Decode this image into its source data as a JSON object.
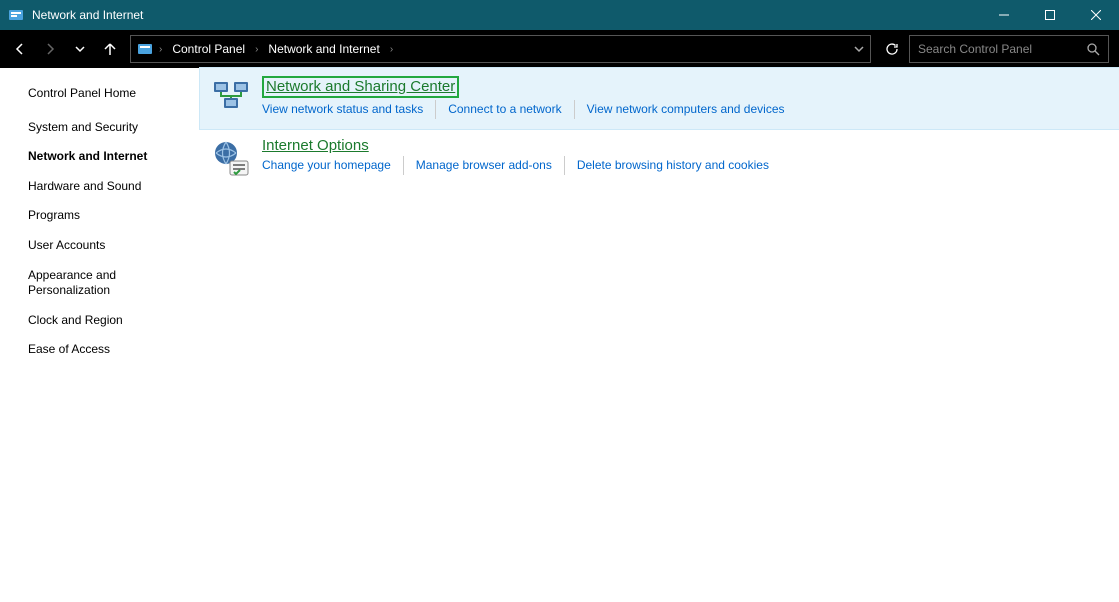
{
  "window": {
    "title": "Network and Internet"
  },
  "breadcrumb": {
    "items": [
      "Control Panel",
      "Network and Internet"
    ]
  },
  "search": {
    "placeholder": "Search Control Panel"
  },
  "sidebar": {
    "home": "Control Panel Home",
    "items": [
      {
        "label": "System and Security",
        "active": false
      },
      {
        "label": "Network and Internet",
        "active": true
      },
      {
        "label": "Hardware and Sound",
        "active": false
      },
      {
        "label": "Programs",
        "active": false
      },
      {
        "label": "User Accounts",
        "active": false
      },
      {
        "label": "Appearance and Personalization",
        "active": false
      },
      {
        "label": "Clock and Region",
        "active": false
      },
      {
        "label": "Ease of Access",
        "active": false
      }
    ]
  },
  "categories": [
    {
      "title": "Network and Sharing Center",
      "highlighted": true,
      "tasks": [
        "View network status and tasks",
        "Connect to a network",
        "View network computers and devices"
      ]
    },
    {
      "title": "Internet Options",
      "highlighted": false,
      "tasks": [
        "Change your homepage",
        "Manage browser add-ons",
        "Delete browsing history and cookies"
      ]
    }
  ]
}
